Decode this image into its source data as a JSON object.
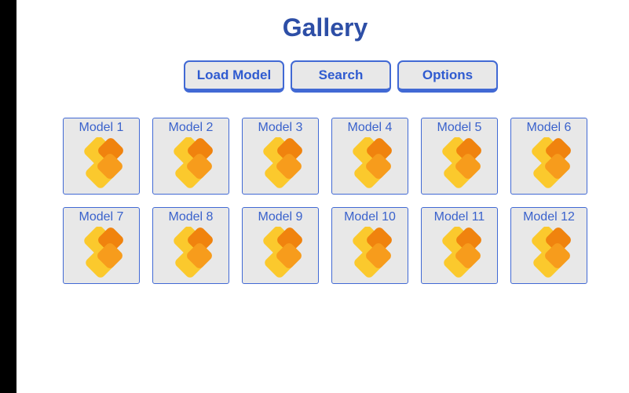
{
  "header": {
    "title": "Gallery"
  },
  "toolbar": {
    "load_model_label": "Load Model",
    "search_label": "Search",
    "options_label": "Options"
  },
  "gallery": {
    "items": [
      {
        "label": "Model 1",
        "icon": "model-icon"
      },
      {
        "label": "Model 2",
        "icon": "model-icon"
      },
      {
        "label": "Model 3",
        "icon": "model-icon"
      },
      {
        "label": "Model 4",
        "icon": "model-icon"
      },
      {
        "label": "Model 5",
        "icon": "model-icon"
      },
      {
        "label": "Model 6",
        "icon": "model-icon"
      },
      {
        "label": "Model 7",
        "icon": "model-icon"
      },
      {
        "label": "Model 8",
        "icon": "model-icon"
      },
      {
        "label": "Model 9",
        "icon": "model-icon"
      },
      {
        "label": "Model 10",
        "icon": "model-icon"
      },
      {
        "label": "Model 11",
        "icon": "model-icon"
      },
      {
        "label": "Model 12",
        "icon": "model-icon"
      }
    ]
  },
  "colors": {
    "title": "#2d4ea6",
    "accent": "#4169d4",
    "tile_bg": "#e8e8e8",
    "icon_yellow": "#fbc92d",
    "icon_orange": "#f79c1c",
    "icon_dark_orange": "#f0830e"
  }
}
